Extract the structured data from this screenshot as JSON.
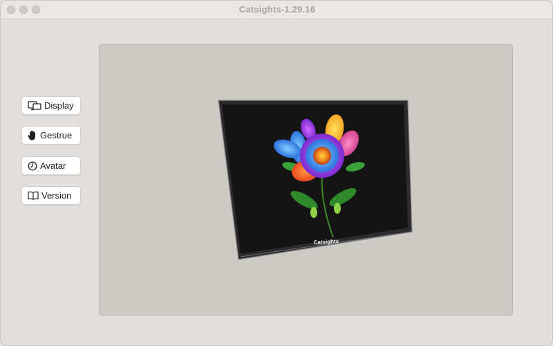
{
  "window": {
    "title": "Catsights-1.29.16"
  },
  "sidebar": {
    "items": [
      {
        "label": "Display",
        "icon": "display-icon"
      },
      {
        "label": "Gestrue",
        "icon": "hand-icon"
      },
      {
        "label": "Avatar",
        "icon": "clock-icon"
      },
      {
        "label": "Version",
        "icon": "book-icon"
      }
    ]
  },
  "preview": {
    "brand_label": "Catsights",
    "screen_image": "colorful-flower"
  }
}
